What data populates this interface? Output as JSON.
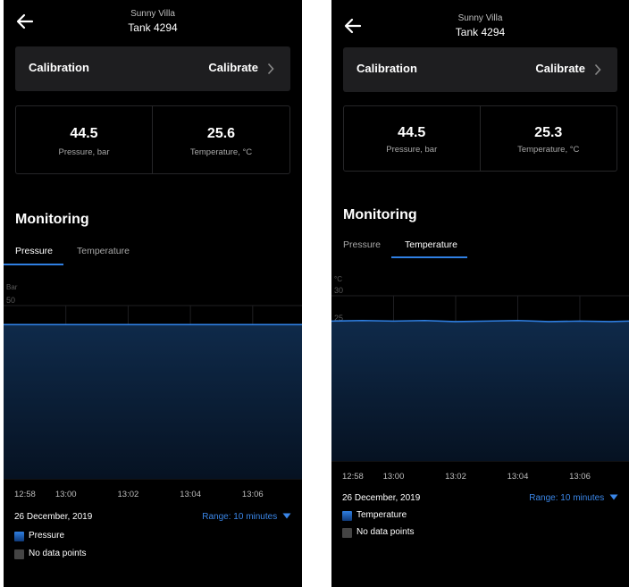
{
  "screens": [
    {
      "site": "Sunny Villa",
      "tank": "Tank 4294",
      "calibration": {
        "label": "Calibration",
        "action": "Calibrate"
      },
      "metrics": [
        {
          "value": "44.5",
          "label": "Pressure, bar"
        },
        {
          "value": "25.6",
          "label": "Temperature, °C"
        }
      ],
      "monitoring_title": "Monitoring",
      "tabs": [
        {
          "label": "Pressure",
          "active": true
        },
        {
          "label": "Temperature",
          "active": false
        }
      ],
      "date": "26 December, 2019",
      "range": "Range: 10 minutes",
      "legend": [
        {
          "label": "Pressure",
          "color": "#1f6fd6"
        },
        {
          "label": "No data points",
          "color": "#444444"
        }
      ],
      "chart_data": {
        "type": "area",
        "ylabel": "Bar",
        "ylim": [
          0,
          50
        ],
        "yticks": [
          0,
          10,
          20,
          30,
          40,
          50
        ],
        "xlim": [
          "12:58",
          "13:07:35"
        ],
        "xticks": [
          "12:58",
          "13:00",
          "13:02",
          "13:04",
          "13:06"
        ],
        "series": [
          {
            "name": "Pressure",
            "x": [
              "12:58",
              "13:00",
              "13:02",
              "13:04",
              "13:06",
              "13:07:35"
            ],
            "values": [
              44.5,
              44.5,
              44.5,
              44.5,
              44.5,
              44.5
            ]
          }
        ],
        "grid": true
      }
    },
    {
      "site": "Sunny Villa",
      "tank": "Tank 4294",
      "calibration": {
        "label": "Calibration",
        "action": "Calibrate"
      },
      "metrics": [
        {
          "value": "44.5",
          "label": "Pressure, bar"
        },
        {
          "value": "25.3",
          "label": "Temperature, °C"
        }
      ],
      "monitoring_title": "Monitoring",
      "tabs": [
        {
          "label": "Pressure",
          "active": false
        },
        {
          "label": "Temperature",
          "active": true
        }
      ],
      "date": "26 December, 2019",
      "range": "Range: 10 minutes",
      "legend": [
        {
          "label": "Temperature",
          "color": "#1f6fd6"
        },
        {
          "label": "No data points",
          "color": "#444444"
        }
      ],
      "chart_data": {
        "type": "area",
        "ylabel": "°C",
        "ylim": [
          0,
          30
        ],
        "yticks": [
          0,
          5,
          10,
          15,
          20,
          25,
          30
        ],
        "xlim": [
          "12:58",
          "13:07:35"
        ],
        "xticks": [
          "12:58",
          "13:00",
          "13:02",
          "13:04",
          "13:06"
        ],
        "series": [
          {
            "name": "Temperature",
            "x": [
              "12:58",
              "12:59",
              "13:00",
              "13:01",
              "13:02",
              "13:03",
              "13:04",
              "13:05",
              "13:06",
              "13:07",
              "13:07:35"
            ],
            "values": [
              25.4,
              25.5,
              25.4,
              25.5,
              25.3,
              25.4,
              25.5,
              25.3,
              25.4,
              25.3,
              25.4
            ]
          }
        ],
        "grid": true
      }
    }
  ],
  "colors": {
    "background": "#000000",
    "panel": "#1e1e20",
    "accent": "#2f7fe2",
    "area_top": "#0f2a4a",
    "area_bottom": "#061222"
  },
  "icons": {
    "back": "arrow-left-icon",
    "chevron": "chevron-right-icon",
    "dropdown": "triangle-down-icon"
  }
}
